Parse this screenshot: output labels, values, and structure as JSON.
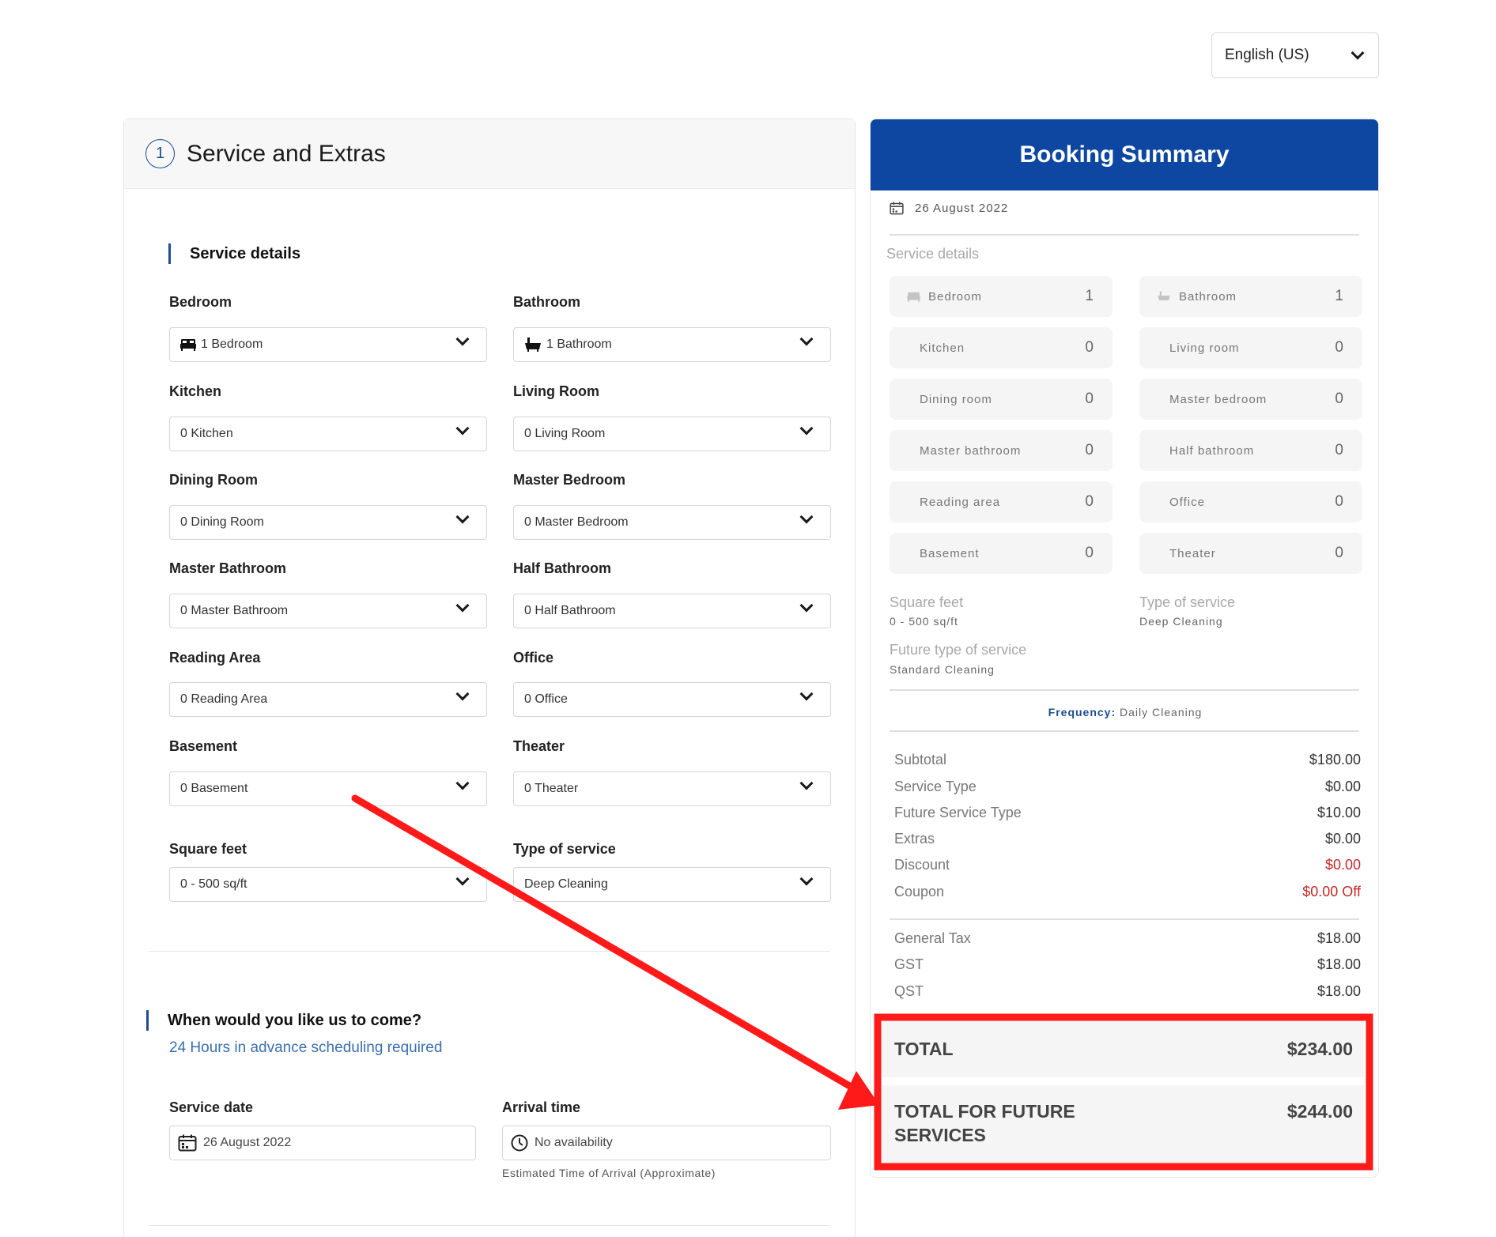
{
  "language": {
    "selected": "English (US)"
  },
  "left": {
    "step_number": "1",
    "title": "Service and Extras",
    "service_details_heading": "Service details",
    "fields": {
      "bedroom": {
        "label": "Bedroom",
        "value": "1 Bedroom"
      },
      "bathroom": {
        "label": "Bathroom",
        "value": "1 Bathroom"
      },
      "kitchen": {
        "label": "Kitchen",
        "value": "0 Kitchen"
      },
      "living_room": {
        "label": "Living Room",
        "value": "0 Living Room"
      },
      "dining_room": {
        "label": "Dining Room",
        "value": "0 Dining Room"
      },
      "master_bedroom": {
        "label": "Master Bedroom",
        "value": "0 Master Bedroom"
      },
      "master_bathroom": {
        "label": "Master Bathroom",
        "value": "0 Master Bathroom"
      },
      "half_bathroom": {
        "label": "Half Bathroom",
        "value": "0 Half Bathroom"
      },
      "reading_area": {
        "label": "Reading Area",
        "value": "0 Reading Area"
      },
      "office": {
        "label": "Office",
        "value": "0 Office"
      },
      "basement": {
        "label": "Basement",
        "value": "0 Basement"
      },
      "theater": {
        "label": "Theater",
        "value": "0 Theater"
      },
      "square_feet": {
        "label": "Square feet",
        "value": "0 - 500 sq/ft"
      },
      "type_of_service": {
        "label": "Type of service",
        "value": "Deep Cleaning"
      }
    },
    "schedule": {
      "heading": "When would you like us to come?",
      "advance_note": "24 Hours in advance scheduling required",
      "service_date_label": "Service date",
      "service_date_value": "26 August 2022",
      "arrival_time_label": "Arrival time",
      "arrival_time_value": "No availability",
      "arrival_note": "Estimated Time of Arrival (Approximate)"
    }
  },
  "summary": {
    "title": "Booking Summary",
    "date": "26 August 2022",
    "service_details_label": "Service details",
    "items": {
      "bedroom": {
        "label": "Bedroom",
        "count": "1"
      },
      "bathroom": {
        "label": "Bathroom",
        "count": "1"
      },
      "kitchen": {
        "label": "Kitchen",
        "count": "0"
      },
      "living_room": {
        "label": "Living room",
        "count": "0"
      },
      "dining_room": {
        "label": "Dining room",
        "count": "0"
      },
      "master_bedroom": {
        "label": "Master bedroom",
        "count": "0"
      },
      "master_bathroom": {
        "label": "Master bathroom",
        "count": "0"
      },
      "half_bathroom": {
        "label": "Half bathroom",
        "count": "0"
      },
      "reading_area": {
        "label": "Reading area",
        "count": "0"
      },
      "office": {
        "label": "Office",
        "count": "0"
      },
      "basement": {
        "label": "Basement",
        "count": "0"
      },
      "theater": {
        "label": "Theater",
        "count": "0"
      }
    },
    "square_feet_label": "Square feet",
    "square_feet_value": "0 - 500 sq/ft",
    "type_of_service_label": "Type of service",
    "type_of_service_value": "Deep Cleaning",
    "future_type_label": "Future type of service",
    "future_type_value": "Standard Cleaning",
    "frequency_label": "Frequency:",
    "frequency_value": "Daily Cleaning",
    "lines": {
      "subtotal": {
        "label": "Subtotal",
        "value": "$180.00"
      },
      "service_type": {
        "label": "Service Type",
        "value": "$0.00"
      },
      "future_service_type": {
        "label": "Future Service Type",
        "value": "$10.00"
      },
      "extras": {
        "label": "Extras",
        "value": "$0.00"
      },
      "discount": {
        "label": "Discount",
        "value": "$0.00"
      },
      "coupon": {
        "label": "Coupon",
        "value": "$0.00 Off"
      },
      "general_tax": {
        "label": "General Tax",
        "value": "$18.00"
      },
      "gst": {
        "label": "GST",
        "value": "$18.00"
      },
      "qst": {
        "label": "QST",
        "value": "$18.00"
      }
    },
    "total": {
      "label": "TOTAL",
      "value": "$234.00"
    },
    "total_future": {
      "label_line1": "TOTAL FOR FUTURE",
      "label_line2": "SERVICES",
      "value": "$244.00"
    }
  },
  "colors": {
    "brand_blue": "#0d47a1",
    "accent_blue": "#1d4d8f",
    "discount_red": "#c62828",
    "annotation_red": "#ff1a1a"
  }
}
